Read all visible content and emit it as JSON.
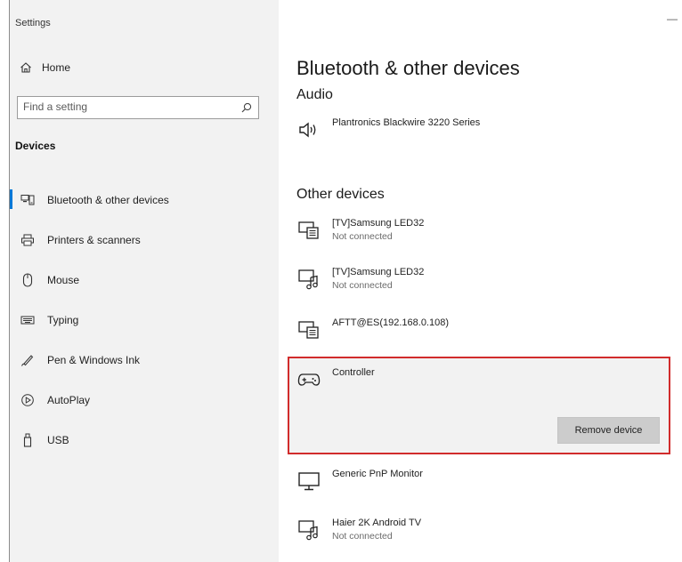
{
  "window": {
    "title": "Settings",
    "minimize_label": "—"
  },
  "sidebar": {
    "home_label": "Home",
    "search_placeholder": "Find a setting",
    "section_label": "Devices",
    "items": [
      {
        "label": "Bluetooth & other devices",
        "icon": "bluetooth-devices-icon",
        "active": true
      },
      {
        "label": "Printers & scanners",
        "icon": "printer-icon",
        "active": false
      },
      {
        "label": "Mouse",
        "icon": "mouse-icon",
        "active": false
      },
      {
        "label": "Typing",
        "icon": "keyboard-icon",
        "active": false
      },
      {
        "label": "Pen & Windows Ink",
        "icon": "pen-icon",
        "active": false
      },
      {
        "label": "AutoPlay",
        "icon": "autoplay-icon",
        "active": false
      },
      {
        "label": "USB",
        "icon": "usb-icon",
        "active": false
      }
    ]
  },
  "main": {
    "title": "Bluetooth & other devices",
    "audio_heading": "Audio",
    "audio_device": {
      "name": "Plantronics Blackwire 3220 Series",
      "icon": "speaker-icon"
    },
    "other_heading": "Other devices",
    "other_devices": [
      {
        "name": "[TV]Samsung LED32",
        "status": "Not connected",
        "icon": "tv-device-icon"
      },
      {
        "name": "[TV]Samsung LED32",
        "status": "Not connected",
        "icon": "media-device-icon"
      },
      {
        "name": "AFTT@ES(192.168.0.108)",
        "status": "",
        "icon": "tv-device-icon"
      },
      {
        "name": "Controller",
        "status": "",
        "icon": "gamepad-icon",
        "selected": true
      },
      {
        "name": "Generic PnP Monitor",
        "status": "",
        "icon": "monitor-icon"
      },
      {
        "name": "Haier 2K Android TV",
        "status": "Not connected",
        "icon": "media-device-icon"
      }
    ],
    "remove_button": "Remove device"
  },
  "colors": {
    "accent": "#0078d7",
    "highlight_border": "#d12c2c",
    "sidebar_bg": "#f2f2f2"
  }
}
